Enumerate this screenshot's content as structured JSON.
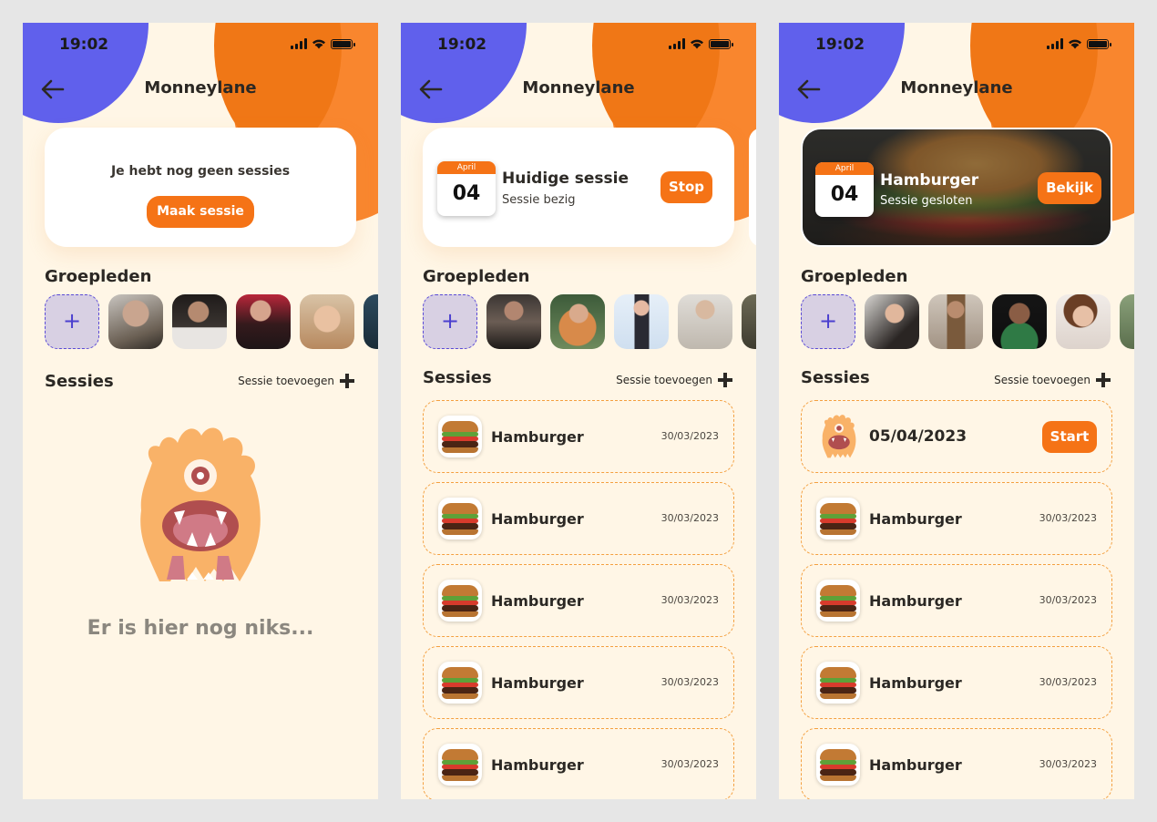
{
  "status": {
    "time": "19:02"
  },
  "header": {
    "title": "Monneylane"
  },
  "sections": {
    "members_title": "Groepleden",
    "sessions_title": "Sessies",
    "add_session": "Sessie toevoegen"
  },
  "screen1": {
    "empty_card_text": "Je hebt nog geen sessies",
    "create_button": "Maak sessie",
    "empty_message": "Er is hier nog niks..."
  },
  "screen2": {
    "calendar": {
      "month": "April",
      "day": "04"
    },
    "title": "Huidige sessie",
    "subtitle": "Sessie bezig",
    "button": "Stop",
    "rows": [
      {
        "title": "Hamburger",
        "date": "30/03/2023"
      },
      {
        "title": "Hamburger",
        "date": "30/03/2023"
      },
      {
        "title": "Hamburger",
        "date": "30/03/2023"
      },
      {
        "title": "Hamburger",
        "date": "30/03/2023"
      },
      {
        "title": "Hamburger",
        "date": "30/03/2023"
      }
    ]
  },
  "screen3": {
    "calendar": {
      "month": "April",
      "day": "04"
    },
    "title": "Hamburger",
    "subtitle": "Sessie gesloten",
    "button": "Bekijk",
    "planned": {
      "date": "05/04/2023",
      "button": "Start"
    },
    "rows": [
      {
        "title": "Hamburger",
        "date": "30/03/2023"
      },
      {
        "title": "Hamburger",
        "date": "30/03/2023"
      },
      {
        "title": "Hamburger",
        "date": "30/03/2023"
      },
      {
        "title": "Hamburger",
        "date": "30/03/2023"
      }
    ]
  },
  "colors": {
    "accent": "#f57316",
    "purple": "#6060ec",
    "background": "#fff6e6"
  },
  "icons": [
    "back-arrow-icon",
    "signal-icon",
    "wifi-icon",
    "battery-icon",
    "plus-icon",
    "monster-icon",
    "hamburger-icon"
  ]
}
